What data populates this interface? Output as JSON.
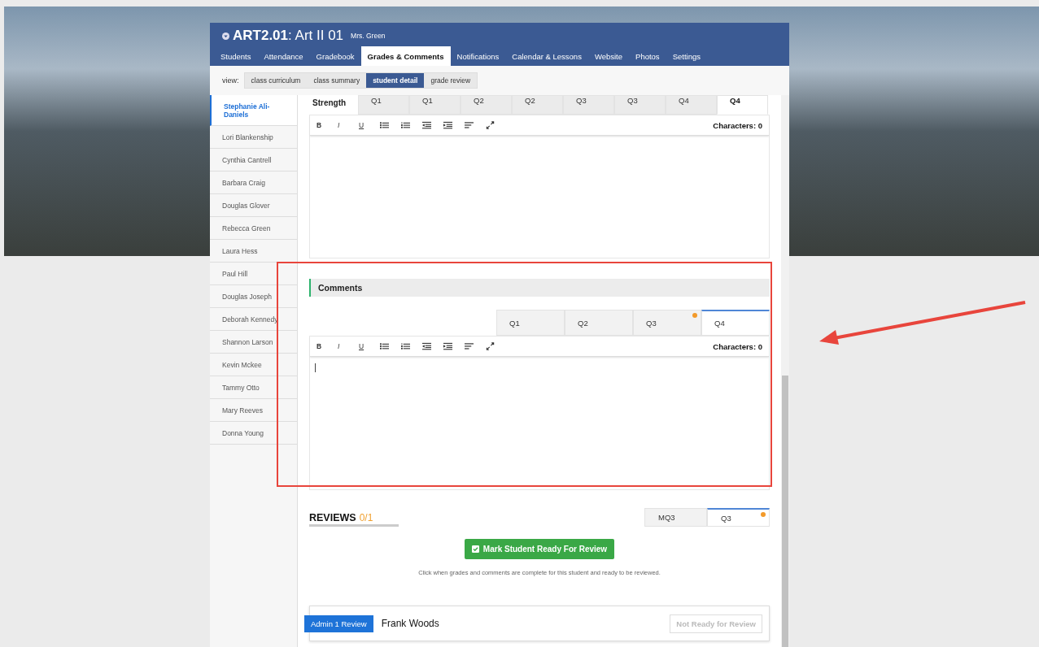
{
  "header": {
    "course_code": "ART2.01",
    "course_name": ": Art II 01",
    "teacher": "Mrs. Green"
  },
  "tabs": [
    {
      "label": "Students",
      "selected": false
    },
    {
      "label": "Attendance",
      "selected": false
    },
    {
      "label": "Gradebook",
      "selected": false
    },
    {
      "label": "Grades & Comments",
      "selected": true
    },
    {
      "label": "Notifications",
      "selected": false
    },
    {
      "label": "Calendar & Lessons",
      "selected": false
    },
    {
      "label": "Website",
      "selected": false
    },
    {
      "label": "Photos",
      "selected": false
    },
    {
      "label": "Settings",
      "selected": false
    }
  ],
  "view": {
    "label": "view:",
    "options": [
      {
        "label": "class curriculum",
        "selected": false
      },
      {
        "label": "class summary",
        "selected": false
      },
      {
        "label": "student detail",
        "selected": true
      },
      {
        "label": "grade review",
        "selected": false
      }
    ]
  },
  "students": [
    {
      "name": "Stephanie Ali-Daniels",
      "selected": true
    },
    {
      "name": "Lori Blankenship",
      "selected": false
    },
    {
      "name": "Cynthia Cantrell",
      "selected": false
    },
    {
      "name": "Barbara Craig",
      "selected": false
    },
    {
      "name": "Douglas Glover",
      "selected": false
    },
    {
      "name": "Rebecca Green",
      "selected": false
    },
    {
      "name": "Laura Hess",
      "selected": false
    },
    {
      "name": "Paul Hill",
      "selected": false
    },
    {
      "name": "Douglas Joseph",
      "selected": false
    },
    {
      "name": "Deborah Kennedy",
      "selected": false
    },
    {
      "name": "Shannon Larson",
      "selected": false
    },
    {
      "name": "Kevin Mckee",
      "selected": false
    },
    {
      "name": "Tammy Otto",
      "selected": false
    },
    {
      "name": "Mary Reeves",
      "selected": false
    },
    {
      "name": "Donna Young",
      "selected": false
    }
  ],
  "strength": {
    "title": "Strength",
    "tabs": [
      {
        "label": "Q1",
        "selected": false,
        "flag": false
      },
      {
        "label": "Q1",
        "selected": false,
        "flag": false
      },
      {
        "label": "Q2",
        "selected": false,
        "flag": false
      },
      {
        "label": "Q2",
        "selected": false,
        "flag": false
      },
      {
        "label": "Q3",
        "selected": false,
        "flag": false
      },
      {
        "label": "Q3",
        "selected": false,
        "flag": false
      },
      {
        "label": "Q4",
        "selected": false,
        "flag": false
      },
      {
        "label": "Q4",
        "selected": true,
        "flag": false
      }
    ],
    "toolbar": {
      "format_buttons": [
        "B",
        "I",
        "U"
      ],
      "char_count": "Characters: 0"
    }
  },
  "comments": {
    "title": "Comments",
    "tabs": [
      {
        "label": "Q1",
        "selected": false,
        "flag": false
      },
      {
        "label": "Q2",
        "selected": false,
        "flag": false
      },
      {
        "label": "Q3",
        "selected": false,
        "flag": true
      },
      {
        "label": "Q4",
        "selected": true,
        "flag": false
      }
    ],
    "toolbar": {
      "format_buttons": [
        "B",
        "I",
        "U"
      ],
      "char_count": "Characters: 0"
    }
  },
  "reviews": {
    "title": "REVIEWS",
    "count": "0/1",
    "tabs": [
      {
        "label": "MQ3",
        "selected": false,
        "flag": false
      },
      {
        "label": "Q3",
        "selected": true,
        "flag": true
      }
    ],
    "button": "Mark Student Ready For Review",
    "hint": "Click when grades and comments are complete for this student and ready to be reviewed.",
    "card": {
      "badge": "Admin 1 Review",
      "name": "Frank Woods",
      "status": "Not Ready for Review"
    }
  },
  "annotation": {
    "highlight": true,
    "arrow": true
  }
}
